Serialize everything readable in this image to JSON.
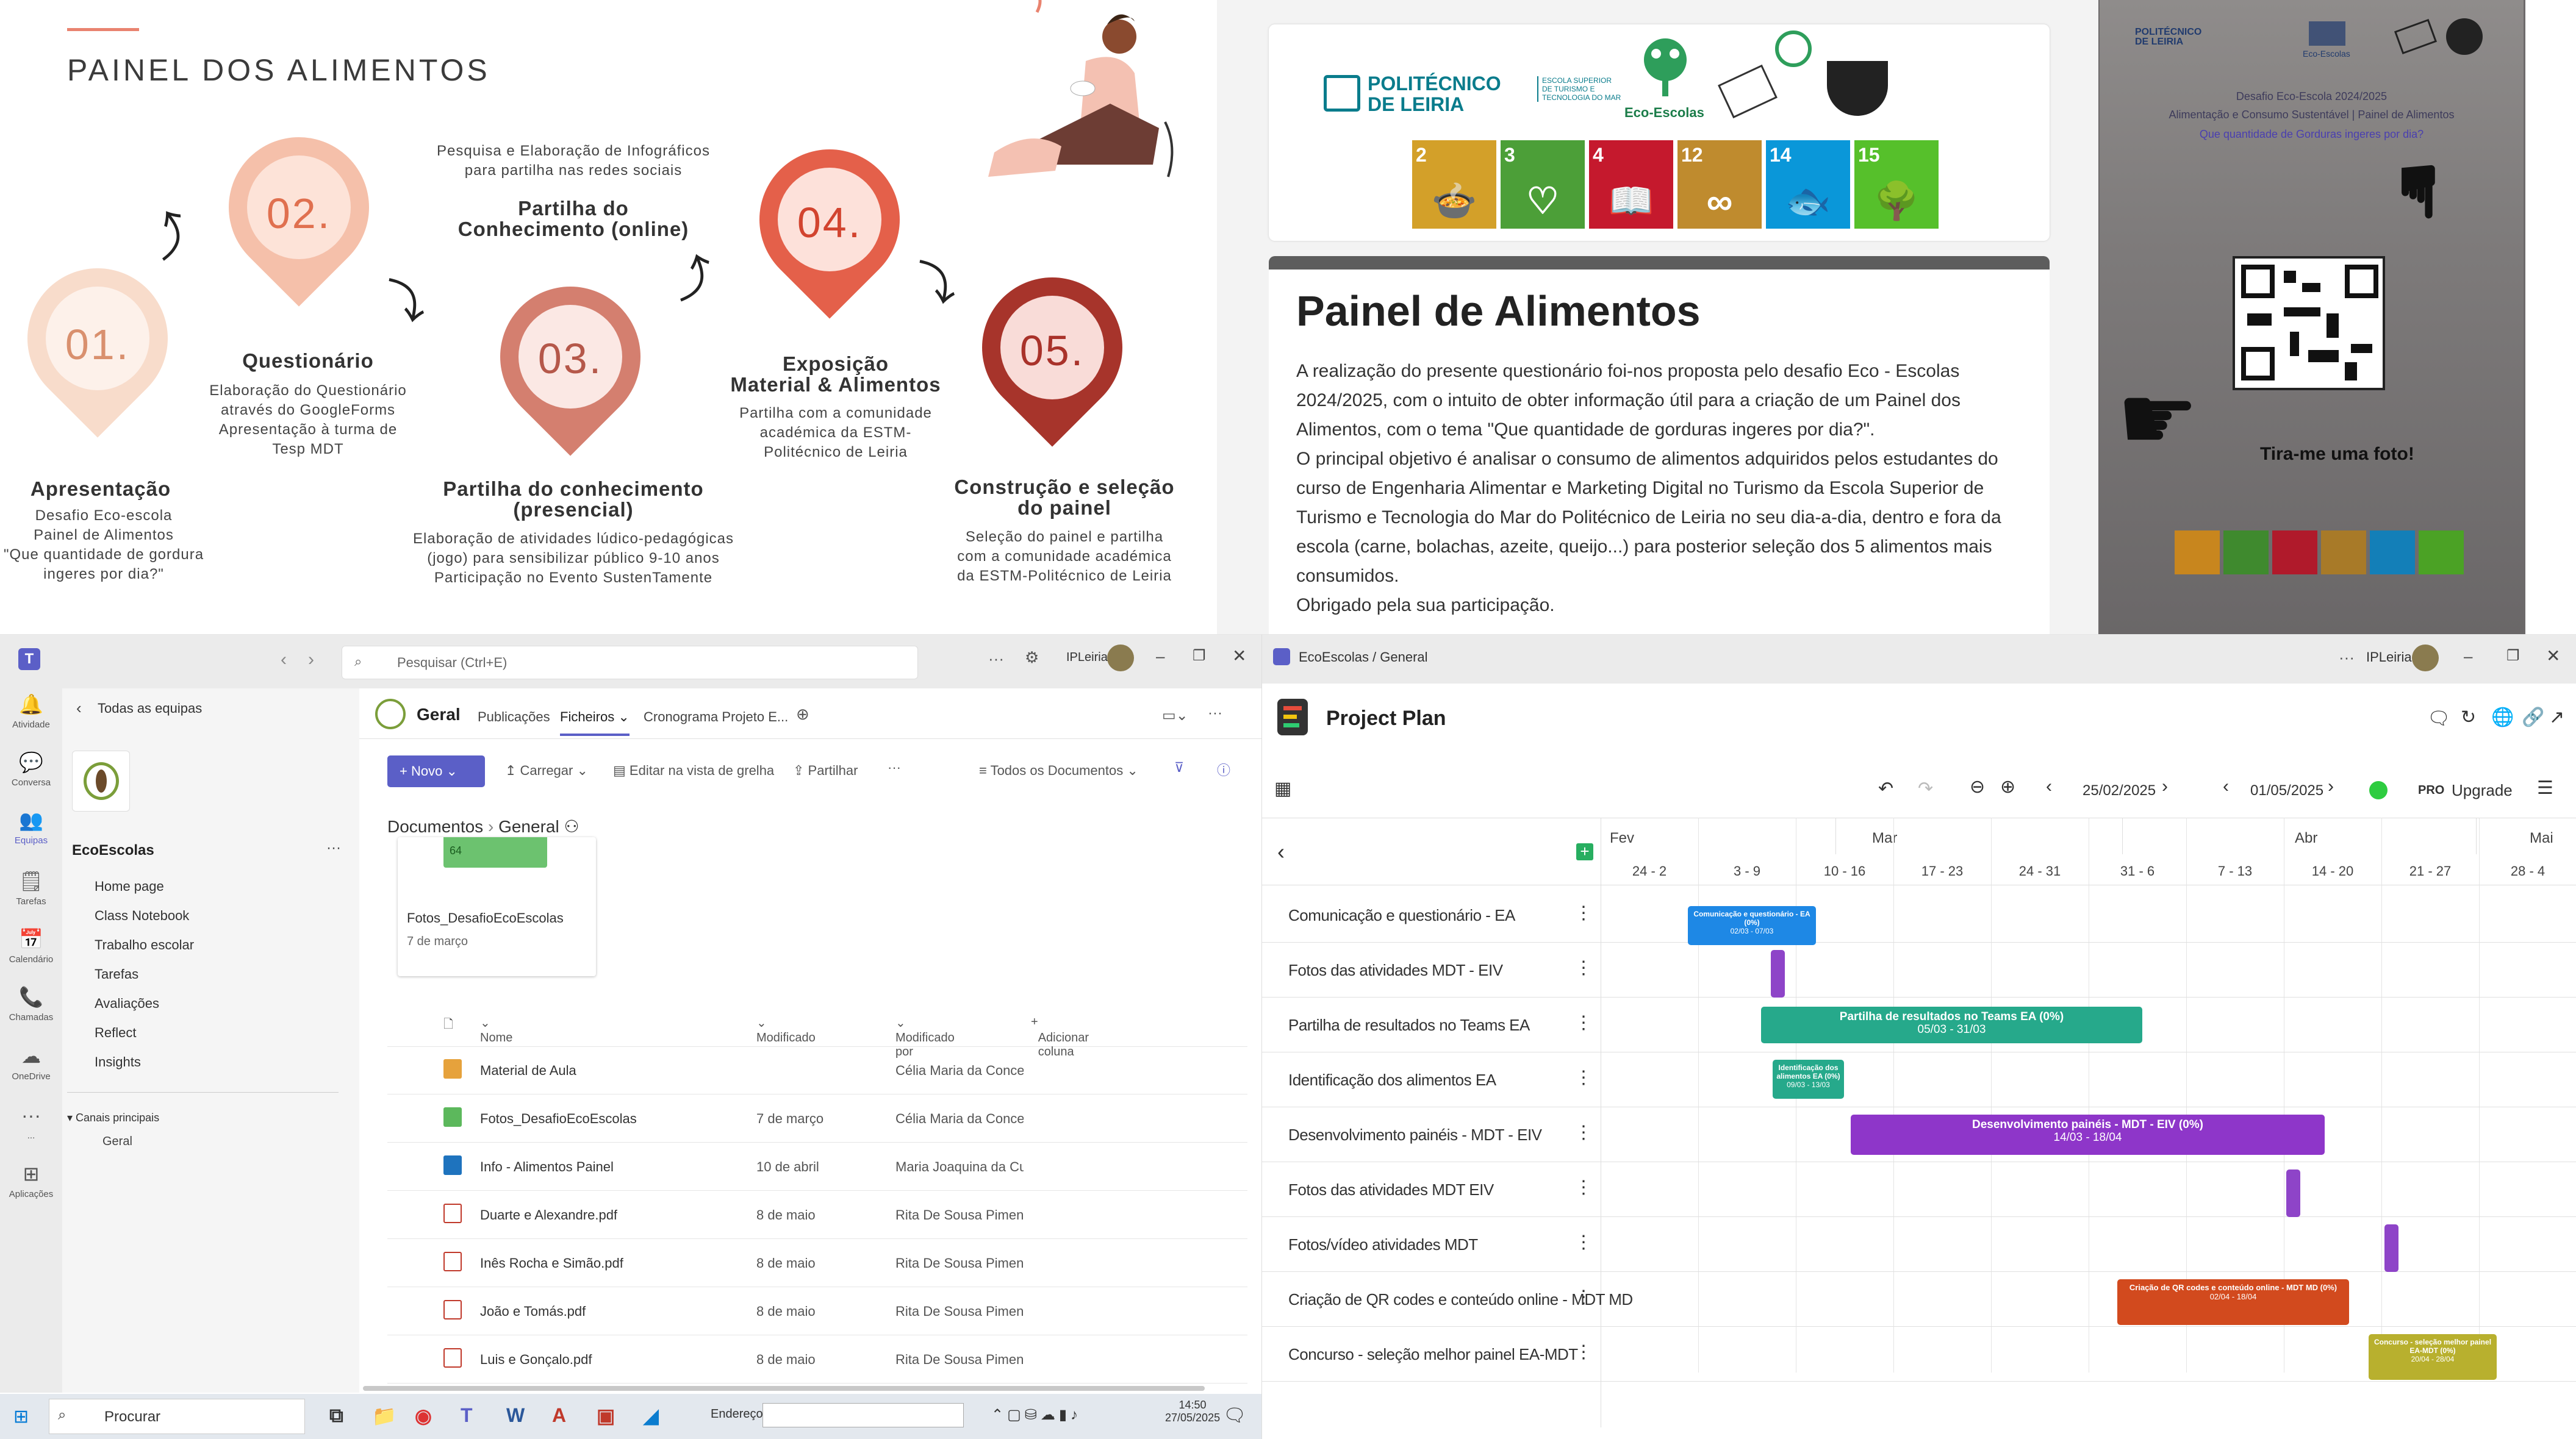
{
  "infographic": {
    "title": "PAINEL DOS ALIMENTOS",
    "steps": [
      {
        "num": "01.",
        "title": "Apresentação",
        "desc": "Desafio Eco-escola\nPainel de Alimentos\n\"Que quantidade de gordura\ningeres por dia?\""
      },
      {
        "num": "02.",
        "title": "Questionário",
        "desc": "Elaboração do Questionário\natravés do GoogleForms\nApresentação à turma de\nTesp MDT"
      },
      {
        "num": "03.",
        "title": "Partilha do conhecimento\n(presencial)",
        "desc": "Elaboração de atividades lúdico-pedagógicas\n(jogo) para sensibilizar público 9-10 anos\nParticipação no Evento SustenTamente"
      },
      {
        "num": "04.",
        "title": "Exposição\nMaterial & Alimentos",
        "desc": "Partilha com a comunidade\nacadémica da ESTM-\nPolitécnico de Leiria"
      },
      {
        "num": "05.",
        "title": "Construção e seleção\ndo painel",
        "desc": "Seleção do painel e partilha\ncom a comunidade académica\nda ESTM-Politécnico de Leiria"
      }
    ],
    "online": {
      "top": "Pesquisa e Elaboração de Infográficos\npara partilha nas redes sociais",
      "title": "Partilha do\nConhecimento (online)"
    }
  },
  "poster": {
    "logo_line1": "POLITÉCNICO",
    "logo_line2": "DE LEIRIA",
    "logo_sub": "ESCOLA SUPERIOR\nDE TURISMO E\nTECNOLOGIA DO MAR",
    "eco_label": "Eco-Escolas",
    "sdgs": [
      {
        "n": "2",
        "t": "ERRADICAR\nA FOME",
        "color": "#d3a029",
        "icon": "bowl-icon",
        "glyph": "🍲"
      },
      {
        "n": "3",
        "t": "SAÚDE\nDE QUALIDADE",
        "color": "#4c9f38",
        "icon": "heartbeat-icon",
        "glyph": "♡"
      },
      {
        "n": "4",
        "t": "EDUCAÇÃO\nDE QUALIDADE",
        "color": "#c5192d",
        "icon": "book-icon",
        "glyph": "📖"
      },
      {
        "n": "12",
        "t": "PRODUÇÃO\nE CONSUMO\nSUSTENTÁVEIS",
        "color": "#bf8b2e",
        "icon": "infinity-icon",
        "glyph": "∞"
      },
      {
        "n": "14",
        "t": "PROTEGER A\nVIDA MARINHA",
        "color": "#0a97d9",
        "icon": "fish-icon",
        "glyph": "🐟"
      },
      {
        "n": "15",
        "t": "PROTEGER A\nVIDA TERRESTRE",
        "color": "#56c02b",
        "icon": "tree-icon",
        "glyph": "🌳"
      }
    ],
    "heading": "Painel de Alimentos",
    "p1": "A realização do presente questionário foi-nos proposta pelo desafio Eco - Escolas 2024/2025, com o intuito de obter informação útil para a criação de um Painel dos Alimentos, com o tema \"Que quantidade de gorduras ingeres por dia?\".",
    "p2": "O principal objetivo é analisar o consumo de alimentos adquiridos pelos estudantes do curso de Engenharia Alimentar e Marketing Digital no Turismo da Escola Superior de Turismo e Tecnologia do Mar do Politécnico de Leiria no seu dia-a-dia, dentro e fora da escola (carne, bolachas, azeite, queijo...) para posterior seleção dos 5 alimentos mais consumidos.",
    "p3": "Obrigado pela sua participação."
  },
  "photo": {
    "logo": "POLITÉCNICO\nDE LEIRIA",
    "eco": "Eco-Escolas",
    "line1": "Desafio Eco-Escola 2024/2025",
    "line2": "Alimentação e Consumo Sustentável  |  Painel de Alimentos",
    "line3": "Que quantidade de Gorduras ingeres por dia?",
    "cta": "Tira-me uma foto!"
  },
  "teams": {
    "search_placeholder": "Pesquisar (Ctrl+E)",
    "org": "IPLeiria",
    "rail": [
      {
        "label": "Atividade",
        "icon": "bell-icon",
        "glyph": "🔔"
      },
      {
        "label": "Conversa",
        "icon": "chat-icon",
        "glyph": "💬"
      },
      {
        "label": "Equipas",
        "icon": "teams-icon",
        "glyph": "👥"
      },
      {
        "label": "Tarefas",
        "icon": "tasks-icon",
        "glyph": "🗒"
      },
      {
        "label": "Calendário",
        "icon": "calendar-icon",
        "glyph": "📅"
      },
      {
        "label": "Chamadas",
        "icon": "phone-icon",
        "glyph": "📞"
      },
      {
        "label": "OneDrive",
        "icon": "cloud-icon",
        "glyph": "☁"
      },
      {
        "label": "...",
        "icon": "more-icon",
        "glyph": "···"
      },
      {
        "label": "Aplicações",
        "icon": "apps-icon",
        "glyph": "⊞"
      }
    ],
    "back_label": "Todas as equipas",
    "team_name": "EcoEscolas",
    "team_nav": [
      "Home page",
      "Class Notebook",
      "Trabalho escolar",
      "Tarefas",
      "Avaliações",
      "Reflect",
      "Insights"
    ],
    "channels_label": "Canais principais",
    "channel": "Geral",
    "channel_title": "Geral",
    "tabs": [
      "Publicações",
      "Ficheiros",
      "Cronograma Projeto E..."
    ],
    "toolbar": {
      "new": "Novo",
      "upload": "Carregar",
      "grid": "Editar na vista de grelha",
      "share": "Partilhar",
      "all_docs": "Todos os Documentos"
    },
    "breadcrumb": [
      "Documentos",
      "General"
    ],
    "folder_card": {
      "count": "64",
      "name": "Fotos_DesafioEcoEscolas",
      "date": "7 de março"
    },
    "columns": {
      "name": "Nome",
      "modified": "Modificado",
      "by": "Modificado por",
      "add": "Adicionar coluna"
    },
    "files": [
      {
        "name": "Material de Aula",
        "modified": "",
        "by": "Célia Maria da Conceiç",
        "type": "folder-special"
      },
      {
        "name": "Fotos_DesafioEcoEscolas",
        "modified": "7 de março",
        "by": "Célia Maria da Conceiç",
        "type": "folder-green"
      },
      {
        "name": "Info - Alimentos Painel",
        "modified": "10 de abril",
        "by": "Maria Joaquina da Cur",
        "type": "folder-blue"
      },
      {
        "name": "Duarte e Alexandre.pdf",
        "modified": "8 de maio",
        "by": "Rita De Sousa Pimenta",
        "type": "pdf"
      },
      {
        "name": "Inês Rocha e Simão.pdf",
        "modified": "8 de maio",
        "by": "Rita De Sousa Pimenta",
        "type": "pdf"
      },
      {
        "name": "João e Tomás.pdf",
        "modified": "8 de maio",
        "by": "Rita De Sousa Pimenta",
        "type": "pdf"
      },
      {
        "name": "Luis e Gonçalo.pdf",
        "modified": "8 de maio",
        "by": "Rita De Sousa Pimenta",
        "type": "pdf"
      }
    ]
  },
  "taskbar": {
    "search": "Procurar",
    "address": "Endereço",
    "time": "14:50",
    "date": "27/05/2025"
  },
  "plan": {
    "breadcrumb": "EcoEscolas / General",
    "org": "IPLeiria",
    "title": "Project Plan",
    "date_from": "25/02/2025",
    "date_to": "01/05/2025",
    "pro": "PRO",
    "upgrade": "Upgrade",
    "months": [
      "Fev",
      "Mar",
      "Abr",
      "Mai"
    ],
    "weeks": [
      "24 - 2",
      "3 - 9",
      "10 - 16",
      "17 - 23",
      "24 - 31",
      "31 - 6",
      "7 - 13",
      "14 - 20",
      "21 - 27",
      "28 - 4"
    ],
    "tasks": [
      {
        "label": "Comunicação e questionário - EA",
        "bar1": "Comunicação e questionário - EA (0%)",
        "bar2": "02/03 - 07/03",
        "color": "#1e88e5"
      },
      {
        "label": "Fotos das atividades MDT - EIV",
        "bar1": "",
        "bar2": "",
        "color": "#8e44c8"
      },
      {
        "label": "Partilha de resultados no Teams EA",
        "bar1": "Partilha de resultados no Teams EA (0%)",
        "bar2": "05/03 - 31/03",
        "color": "#26a98b"
      },
      {
        "label": "Identificação dos alimentos EA",
        "bar1": "Identificação dos alimentos EA (0%)",
        "bar2": "09/03 - 13/03",
        "color": "#26a98b"
      },
      {
        "label": "Desenvolvimento painéis - MDT - EIV",
        "bar1": "Desenvolvimento painéis - MDT - EIV (0%)",
        "bar2": "14/03 - 18/04",
        "color": "#8e36c9"
      },
      {
        "label": "Fotos das atividades MDT EIV",
        "bar1": "",
        "bar2": "",
        "color": "#8e44c8"
      },
      {
        "label": "Fotos/vídeo atividades MDT",
        "bar1": "",
        "bar2": "",
        "color": "#8e44c8"
      },
      {
        "label": "Criação de QR codes e conteúdo online - MDT MD",
        "bar1": "Criação de QR codes e conteúdo online - MDT MD (0%)",
        "bar2": "02/04 - 18/04",
        "color": "#d24a1e"
      },
      {
        "label": "Concurso - seleção melhor painel EA-MDT",
        "bar1": "Concurso - seleção melhor painel EA-MDT (0%)",
        "bar2": "20/04 - 28/04",
        "color": "#b8b02e"
      }
    ]
  }
}
